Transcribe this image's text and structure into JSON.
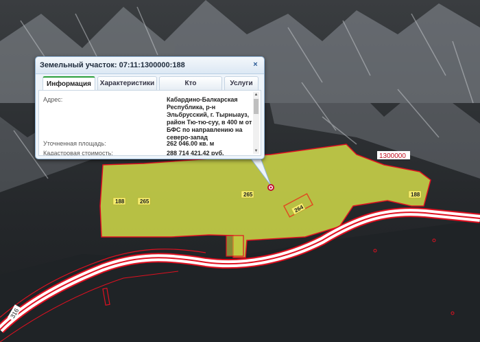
{
  "map": {
    "parcel_labels": [
      "188",
      "265",
      "265",
      "264",
      "188"
    ],
    "district_label": "1300000",
    "road_label": "316",
    "colors": {
      "parcel_fill": "#d8e24a",
      "boundary": "#e01020",
      "road": "#ffffff"
    }
  },
  "popup": {
    "title": "Земельный участок: 07:11:1300000:188",
    "close_icon": "×",
    "tabs": [
      "Информация",
      "Характеристики",
      "Кто обслуживает?",
      "Услуги"
    ],
    "active_tab": "Информация",
    "fields": {
      "address_label": "Адрес:",
      "address_lines": [
        "Кабардино-Балкарская",
        "Республика, р-н",
        "Эльбрусский, г. Тырныауз,",
        "район Тю-тю-суу, в 400 м от",
        "БФС по направлению на",
        "северо-запад"
      ],
      "area_label": "Уточненная площадь:",
      "area_value": "262 046.00 кв. м",
      "cost_label": "Кадастровая стоимость:",
      "cost_value": "288 714 421.42 руб."
    }
  }
}
